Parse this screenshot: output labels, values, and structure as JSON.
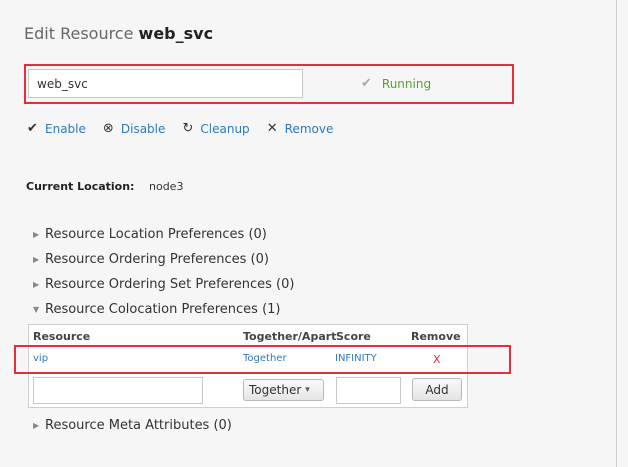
{
  "header": {
    "prefix": "Edit Resource",
    "resource_name": "web_svc"
  },
  "name_field": {
    "value": "web_svc"
  },
  "status": {
    "label": "Running",
    "icon": "check-icon"
  },
  "actions": [
    {
      "label": "Enable",
      "icon": "check-icon"
    },
    {
      "label": "Disable",
      "icon": "disable-icon"
    },
    {
      "label": "Cleanup",
      "icon": "refresh-icon"
    },
    {
      "label": "Remove",
      "icon": "close-icon"
    }
  ],
  "current_location": {
    "label": "Current Location:",
    "value": "node3"
  },
  "preferences": [
    {
      "label": "Resource Location Preferences (0)",
      "expanded": false
    },
    {
      "label": "Resource Ordering Preferences (0)",
      "expanded": false
    },
    {
      "label": "Resource Ordering Set Preferences (0)",
      "expanded": false
    },
    {
      "label": "Resource Colocation Preferences (1)",
      "expanded": true
    },
    {
      "label": "Resource Meta Attributes (0)",
      "expanded": false
    }
  ],
  "colocation_table": {
    "headers": {
      "resource": "Resource",
      "together": "Together/Apart",
      "score": "Score",
      "remove": "Remove"
    },
    "rows": [
      {
        "resource": "vip",
        "together": "Together",
        "score": "INFINITY",
        "remove": "X"
      }
    ],
    "new_row": {
      "together_selected": "Together",
      "add_label": "Add"
    }
  },
  "colors": {
    "link": "#2a7ac0",
    "running": "#5a9e2f",
    "highlight": "#e0303a",
    "remove": "#e0303a"
  }
}
